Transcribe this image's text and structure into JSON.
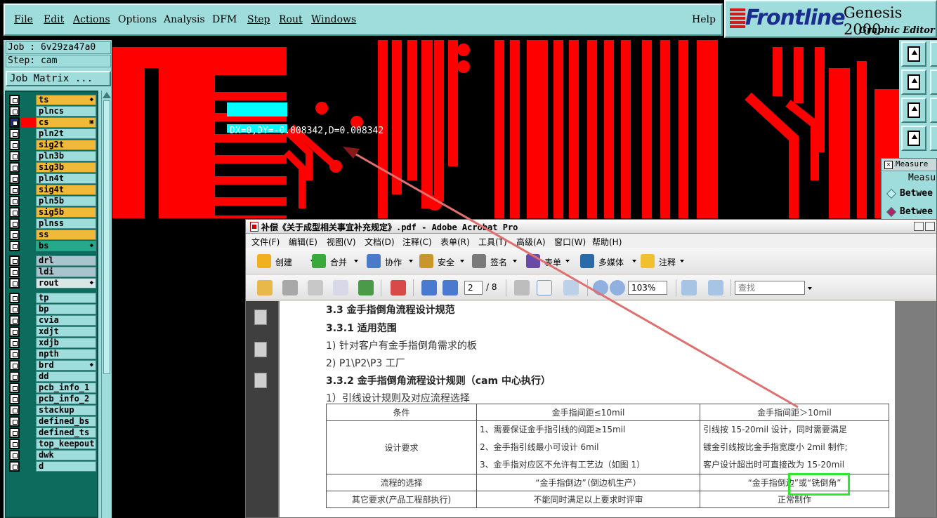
{
  "menubar": {
    "items": [
      "File",
      "Edit",
      "Actions",
      "Options",
      "Analysis",
      "DFM",
      "Step",
      "Rout",
      "Windows"
    ],
    "help": "Help"
  },
  "brand": {
    "name": "Frontline",
    "product": "Genesis 2000",
    "subtitle": "Graphic Editor"
  },
  "job": {
    "job_line": "Job : 6v29za47a0",
    "step_line": "Step: cam",
    "matrix_button": "Job Matrix ..."
  },
  "layers": [
    {
      "name": "ts",
      "color": "#f0b93a",
      "selected": false,
      "mark": "◆"
    },
    {
      "name": "plncs",
      "color": "#9fdcdc",
      "selected": false,
      "mark": ""
    },
    {
      "name": "cs",
      "color": "#f0b93a",
      "selected": true,
      "mark": "▣"
    },
    {
      "name": "pln2t",
      "color": "#9fdcdc",
      "selected": false,
      "mark": ""
    },
    {
      "name": "sig2t",
      "color": "#f0b93a",
      "selected": false,
      "mark": ""
    },
    {
      "name": "pln3b",
      "color": "#9fdcdc",
      "selected": false,
      "mark": ""
    },
    {
      "name": "sig3b",
      "color": "#f0b93a",
      "selected": false,
      "mark": ""
    },
    {
      "name": "pln4t",
      "color": "#9fdcdc",
      "selected": false,
      "mark": ""
    },
    {
      "name": "sig4t",
      "color": "#f0b93a",
      "selected": false,
      "mark": ""
    },
    {
      "name": "pln5b",
      "color": "#9fdcdc",
      "selected": false,
      "mark": ""
    },
    {
      "name": "sig5b",
      "color": "#f0b93a",
      "selected": false,
      "mark": ""
    },
    {
      "name": "plnss",
      "color": "#9fdcdc",
      "selected": false,
      "mark": ""
    },
    {
      "name": "ss",
      "color": "#f0b93a",
      "selected": false,
      "mark": ""
    },
    {
      "name": "bs",
      "color": "#28a88a",
      "selected": false,
      "mark": "◆"
    },
    {
      "name": "drl",
      "color": "#a9c4cc",
      "selected": false,
      "mark": ""
    },
    {
      "name": "ldi",
      "color": "#a9c4cc",
      "selected": false,
      "mark": ""
    },
    {
      "name": "rout",
      "color": "#d9e6e6",
      "selected": false,
      "mark": "◆"
    },
    {
      "name": "tp",
      "color": "#9fdcdc",
      "selected": false,
      "mark": ""
    },
    {
      "name": "bp",
      "color": "#9fdcdc",
      "selected": false,
      "mark": ""
    },
    {
      "name": "cvia",
      "color": "#9fdcdc",
      "selected": false,
      "mark": ""
    },
    {
      "name": "xdjt",
      "color": "#9fdcdc",
      "selected": false,
      "mark": ""
    },
    {
      "name": "xdjb",
      "color": "#9fdcdc",
      "selected": false,
      "mark": ""
    },
    {
      "name": "npth",
      "color": "#9fdcdc",
      "selected": false,
      "mark": ""
    },
    {
      "name": "brd",
      "color": "#9fdcdc",
      "selected": false,
      "mark": "◆"
    },
    {
      "name": "dd",
      "color": "#9fdcdc",
      "selected": false,
      "mark": ""
    },
    {
      "name": "pcb_info_1",
      "color": "#9fdcdc",
      "selected": false,
      "mark": ""
    },
    {
      "name": "pcb_info_2",
      "color": "#9fdcdc",
      "selected": false,
      "mark": ""
    },
    {
      "name": "stackup",
      "color": "#9fdcdc",
      "selected": false,
      "mark": ""
    },
    {
      "name": "defined_bs",
      "color": "#9fdcdc",
      "selected": false,
      "mark": ""
    },
    {
      "name": "defined_ts",
      "color": "#9fdcdc",
      "selected": false,
      "mark": ""
    },
    {
      "name": "top_keepout",
      "color": "#9fdcdc",
      "selected": false,
      "mark": ""
    },
    {
      "name": "dwk",
      "color": "#9fdcdc",
      "selected": false,
      "mark": ""
    },
    {
      "name": "d",
      "color": "#9fdcdc",
      "selected": false,
      "mark": ""
    }
  ],
  "canvas": {
    "measure_readout": "DX=0,DY=-0.008342,D=0.008342"
  },
  "measure_panel": {
    "title": "Measure",
    "header": "Measu",
    "options": [
      "Betwee",
      "Betwee"
    ]
  },
  "acrobat": {
    "title": "补偿《关于成型相关事宜补充规定》.pdf - Adobe Acrobat Pro",
    "menu": [
      "文件(F)",
      "编辑(E)",
      "视图(V)",
      "文档(D)",
      "注释(C)",
      "表单(R)",
      "工具(T)",
      "高级(A)",
      "窗口(W)",
      "帮助(H)"
    ],
    "toolbar1": [
      "创建",
      "合并",
      "协作",
      "安全",
      "签名",
      "表单",
      "多媒体",
      "注释"
    ],
    "page_current": "2",
    "page_total": "/ 8",
    "zoom": "103%",
    "search_placeholder": "查找"
  },
  "document": {
    "h1": "3.3 金手指倒角流程设计规范",
    "h2": "3.3.1  适用范围",
    "l1": "1) 针对客户有金手指倒角需求的板",
    "l2": "2) P1\\P2\\P3 工厂",
    "h3": "3.3.2  金手指倒角流程设计规则（cam 中心执行）",
    "l3": "1）引线设计规则及对应流程选择",
    "table": {
      "header": [
        "条件",
        "金手指间距≤10mil",
        "金手指间距＞10mil"
      ],
      "row1_label": "设计要求",
      "row1_mid": [
        "1、需要保证金手指引线的间距≥15mil",
        "2、金手指引线最小可设计 6mil",
        "3、金手指对应区不允许有工艺边（如图 1）"
      ],
      "row1_right": [
        "引线按 15-20mil 设计，同时需要满足",
        "镀金引线按比金手指宽度小 2mil 制作;",
        "客户设计超出时可直接改为 15-20mil"
      ],
      "row2": [
        "流程的选择",
        "“金手指倒边”（倒边机生产）",
        "“金手指倒边”或“铣倒角”"
      ],
      "row3": [
        "其它要求(产品工程部执行)",
        "不能同时满足以上要求时评审",
        "正常制作"
      ]
    }
  },
  "colors": {
    "copper": "#ff0000",
    "cyan": "#00ffff",
    "highlight": "#2ee82e",
    "arrow": "#e07070"
  }
}
